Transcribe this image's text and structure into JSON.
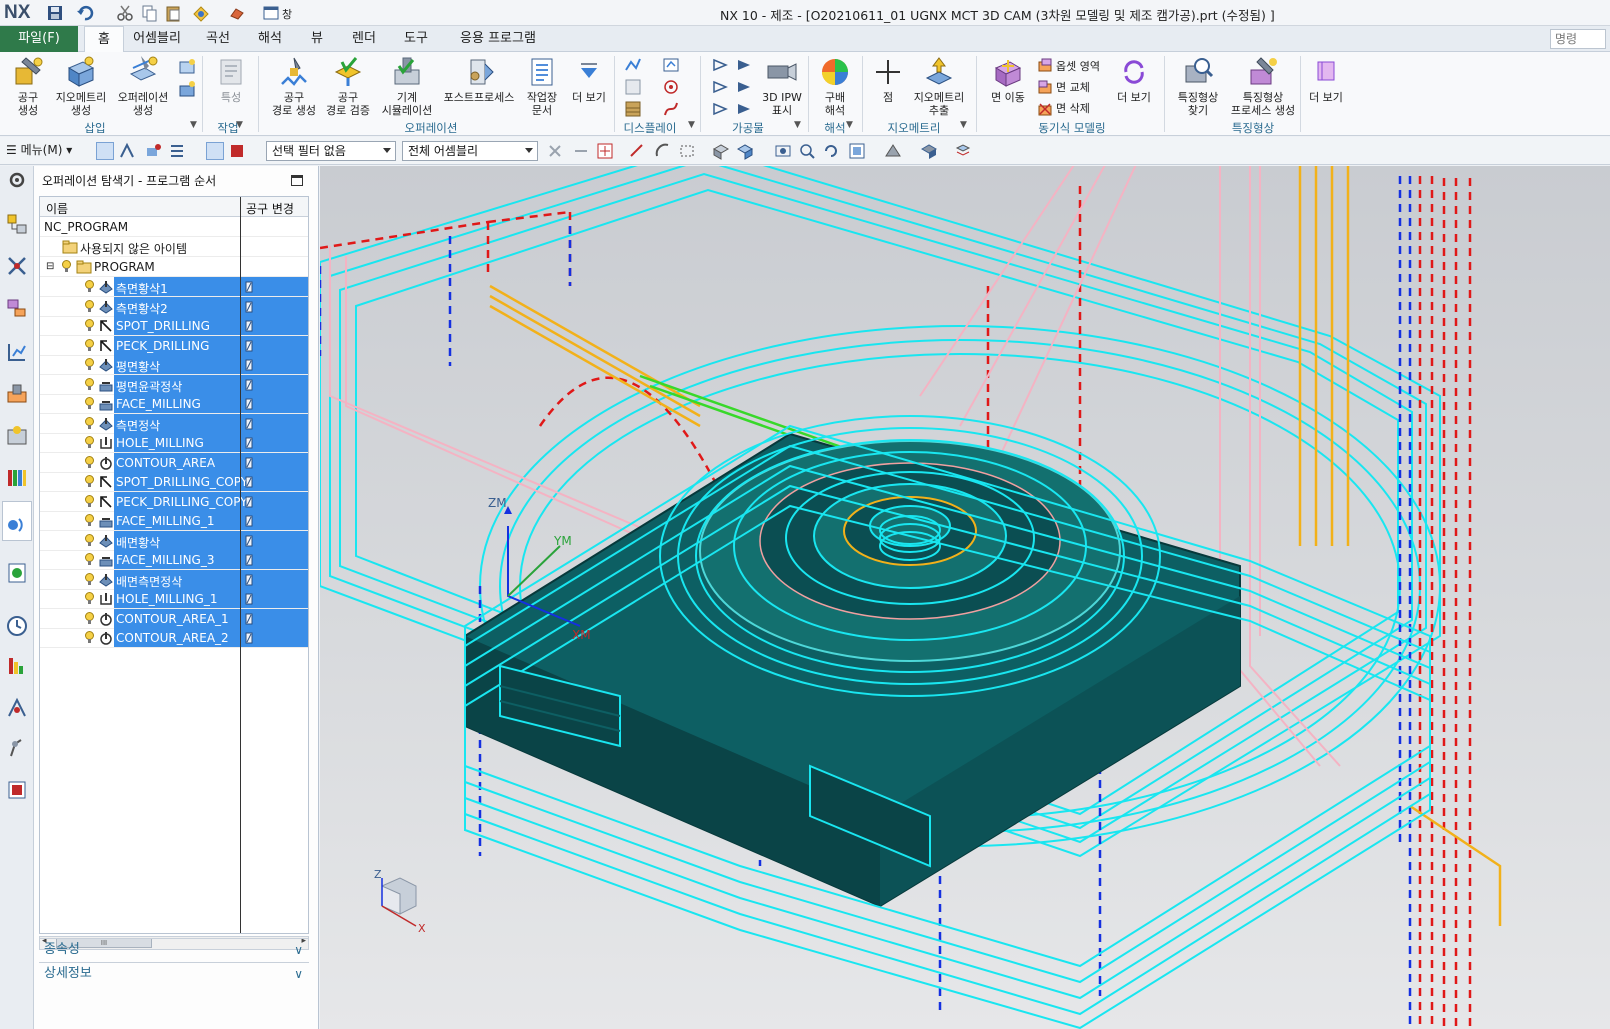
{
  "titlebar": {
    "logo": "NX",
    "title": "NX 10 - 제조 - [O20210611_01 UGNX MCT 3D CAM (3차원 모델링 및 제조 캠가공).prt (수정됨) ]",
    "window_menu": "창"
  },
  "ribbon_tabs": {
    "file": "파일(F)",
    "tabs": [
      "홈",
      "어셈블리",
      "곡선",
      "해석",
      "뷰",
      "렌더",
      "도구",
      "응용 프로그램"
    ],
    "active": "홈",
    "command_search": "명령"
  },
  "ribbon": {
    "insert": {
      "create_tool": "공구\n생성",
      "create_geometry": "지오메트리\n생성",
      "create_operation": "오퍼레이션\n생성",
      "group": "삽입"
    },
    "work": {
      "feature": "특성",
      "group": "작업"
    },
    "operation": {
      "generate_path": "공구\n경로 생성",
      "verify_path": "공구\n경로 검증",
      "machine_sim": "기계\n시뮬레이션",
      "postprocess": "포스트프로세스",
      "shop_doc": "작업장\n문서",
      "more": "더 보기",
      "group": "오퍼레이션"
    },
    "display": {
      "group": "디스플레이"
    },
    "ipw": {
      "ipw": "3D IPW\n표시",
      "group": "가공물"
    },
    "analysis": {
      "gradient": "구배\n해석",
      "group": "해석"
    },
    "geometry": {
      "point": "점",
      "extract": "지오메트리\n추출",
      "group": "지오메트리"
    },
    "sync": {
      "move_face": "면 이동",
      "offset_region": "옵셋 영역",
      "replace_face": "면 교체",
      "delete_face": "면 삭제",
      "more": "더 보기",
      "group": "동기식 모델링"
    },
    "feature": {
      "find_feature": "특징형상\n찾기",
      "feature_process": "특징형상\n프로세스 생성",
      "more": "더 보기",
      "group": "특징형상"
    }
  },
  "toolbar2": {
    "menu": "메뉴(M)",
    "selection_filter": "선택 필터 없음",
    "assembly_scope": "전체 어셈블리"
  },
  "navigator": {
    "title": "오퍼레이션 탐색기 - 프로그램 순서",
    "columns": {
      "name": "이름",
      "tool_change": "공구 변경"
    },
    "root": "NC_PROGRAM",
    "unused": "사용되지 않은 아이템",
    "program": "PROGRAM",
    "operations": [
      {
        "name": "측면황삭1",
        "kind": "cavity"
      },
      {
        "name": "측면황삭2",
        "kind": "cavity"
      },
      {
        "name": "SPOT_DRILLING",
        "kind": "drill"
      },
      {
        "name": "PECK_DRILLING",
        "kind": "drill"
      },
      {
        "name": "평면황삭",
        "kind": "cavity"
      },
      {
        "name": "평면윤곽정삭",
        "kind": "planar"
      },
      {
        "name": "FACE_MILLING",
        "kind": "planar"
      },
      {
        "name": "측면정삭",
        "kind": "cavity"
      },
      {
        "name": "HOLE_MILLING",
        "kind": "hole"
      },
      {
        "name": "CONTOUR_AREA",
        "kind": "contour"
      },
      {
        "name": "SPOT_DRILLING_COPY",
        "kind": "drill"
      },
      {
        "name": "PECK_DRILLING_COPY",
        "kind": "drill"
      },
      {
        "name": "FACE_MILLING_1",
        "kind": "planar"
      },
      {
        "name": "배면황삭",
        "kind": "cavity"
      },
      {
        "name": "FACE_MILLING_3",
        "kind": "planar"
      },
      {
        "name": "배면측면정삭",
        "kind": "cavity"
      },
      {
        "name": "HOLE_MILLING_1",
        "kind": "hole"
      },
      {
        "name": "CONTOUR_AREA_1",
        "kind": "contour"
      },
      {
        "name": "CONTOUR_AREA_2",
        "kind": "contour"
      }
    ],
    "scroll_thumb": "III",
    "dependencies": "종속성",
    "details": "상세정보"
  },
  "graphics": {
    "mcs_z": "ZM",
    "mcs_y": "YM",
    "mcs_x": "XM",
    "triad_z": "Z",
    "triad_x": "X",
    "colors": {
      "background": "#d3d5d8",
      "toolpath": "#19e6f0",
      "part": "#0d5f63",
      "rapid": "#e01818",
      "engage": "#1530e0",
      "approach": "#f4b3c3",
      "departure": "#f2b11a",
      "cut_highlight": "#38d82a"
    }
  }
}
